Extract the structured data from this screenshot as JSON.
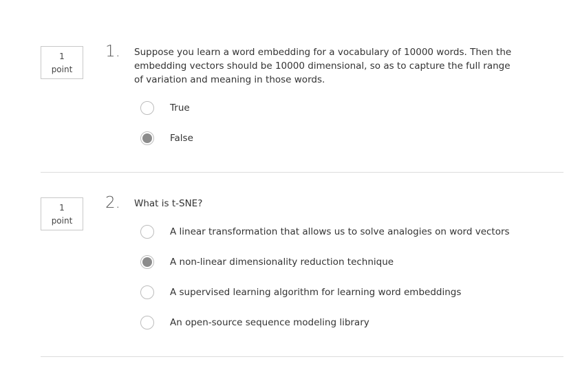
{
  "questions": [
    {
      "points_value": "1",
      "points_unit": "point",
      "number": "1.",
      "text": "Suppose you learn a word embedding for a vocabulary of 10000 words. Then the embedding vectors should be 10000 dimensional, so as to capture the full range of variation and meaning in those words.",
      "options": [
        {
          "label": "True",
          "selected": false
        },
        {
          "label": "False",
          "selected": true
        }
      ]
    },
    {
      "points_value": "1",
      "points_unit": "point",
      "number": "2.",
      "text": "What is t-SNE?",
      "options": [
        {
          "label": "A linear transformation that allows us to solve analogies on word vectors",
          "selected": false
        },
        {
          "label": "A non-linear dimensionality reduction technique",
          "selected": true
        },
        {
          "label": "A supervised learning algorithm for learning word embeddings",
          "selected": false
        },
        {
          "label": "An open-source sequence modeling library",
          "selected": false
        }
      ]
    }
  ],
  "colors": {
    "selected_radio": "#8c8c8c",
    "divider": "#dcdcdc",
    "text": "#333333"
  }
}
